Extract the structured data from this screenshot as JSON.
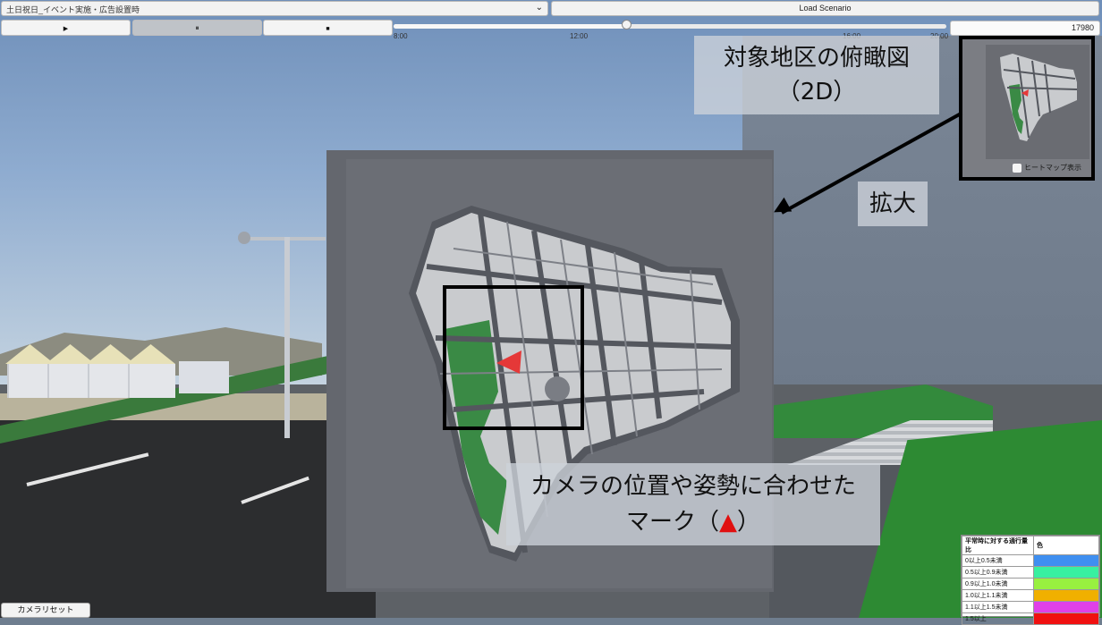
{
  "toolbar": {
    "scenario_select_value": "土日祝日_イベント実施・広告設置時",
    "load_button_label": "Load Scenario",
    "play_icon": "▶",
    "pause_icon": "⏸",
    "stop_icon": "■",
    "time_ticks": [
      "8:00",
      "12:00",
      "16:00",
      "20:00"
    ],
    "time_slider_progress": 0.42,
    "counter_value": "17980"
  },
  "callouts": {
    "overview_line1": "対象地区の俯瞰図",
    "overview_line2": "（2D）",
    "zoom_label": "拡大",
    "mark_line1": "カメラの位置や姿勢に合わせた",
    "mark_line2_prefix": "マーク（",
    "mark_triangle": "▲",
    "mark_line2_suffix": "）"
  },
  "minimap": {
    "heatmap_label": "ヒートマップ表示",
    "heatmap_checked": false
  },
  "legend": {
    "header_left": "平常時に対する通行量比",
    "header_right": "色",
    "rows": [
      {
        "label": "0以上0.5未満",
        "color": "#3f8ff0"
      },
      {
        "label": "0.5以上0.9未満",
        "color": "#38f0a0"
      },
      {
        "label": "0.9以上1.0未満",
        "color": "#98f040"
      },
      {
        "label": "1.0以上1.1未満",
        "color": "#f0b000"
      },
      {
        "label": "1.1以上1.5未満",
        "color": "#e040e8"
      },
      {
        "label": "1.5以上",
        "color": "#f01010"
      }
    ]
  },
  "camera_reset_label": "カメラリセット",
  "colors": {
    "map_building": "#d8dadd",
    "map_green": "#3a8a45",
    "map_road": "#4e5158",
    "camera_marker": "#e53838"
  }
}
